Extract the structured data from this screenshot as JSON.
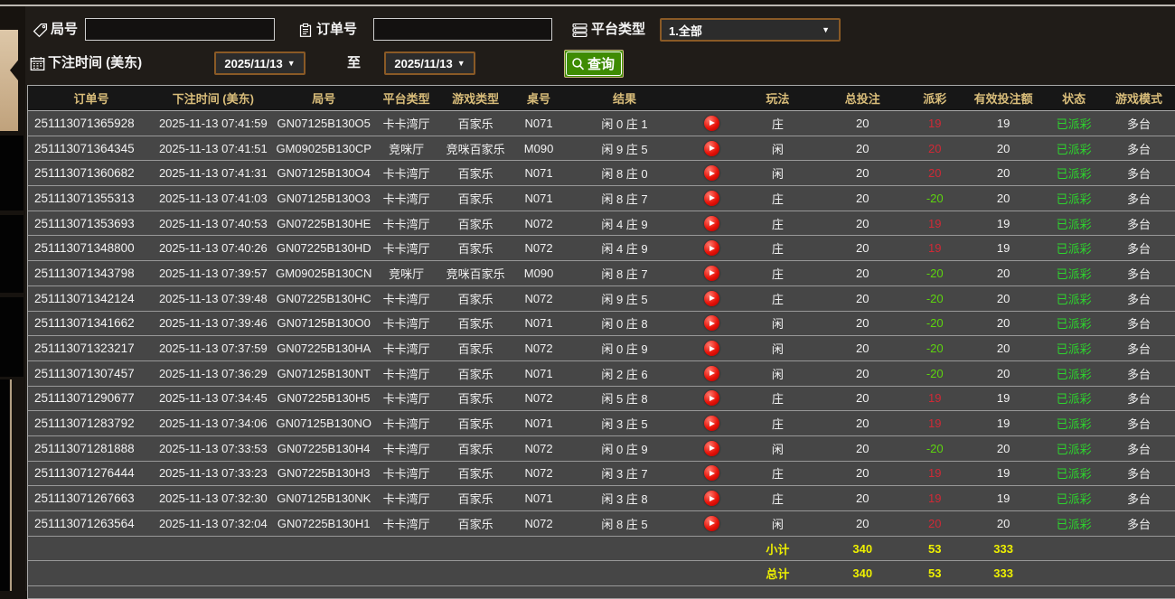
{
  "colors": {
    "payout_positive": "#d02936",
    "payout_negative": "#5dd40e",
    "status_paid_green": "#2dd42d",
    "totals_yellow": "#eef000",
    "header_gold": "#d9bd7a",
    "search_button_green": "#3e8b03",
    "dropdown_border_brown": "#8a5a26"
  },
  "filters": {
    "round": {
      "label": "局号",
      "value": ""
    },
    "order": {
      "label": "订单号",
      "value": ""
    },
    "platform": {
      "label": "平台类型",
      "value": "1.全部"
    },
    "bet_time_label": "下注时间 (美东)",
    "date_from": "2025/11/13",
    "to_label": "至",
    "date_to": "2025/11/13",
    "search_label": "查询"
  },
  "table": {
    "headers": [
      "订单号",
      "下注时间 (美东)",
      "局号",
      "平台类型",
      "游戏类型",
      "桌号",
      "结果",
      "",
      "玩法",
      "总投注",
      "派彩",
      "有效投注额",
      "状态",
      "游戏模式"
    ],
    "rows": [
      {
        "order": "251113071365928",
        "time": "2025-11-13 07:41:59",
        "round": "GN07125B130O5",
        "platform": "卡卡湾厅",
        "game": "百家乐",
        "table_no": "N071",
        "result": "闲 0 庄 1",
        "play": "庄",
        "bet": "20",
        "payout": "19",
        "valid": "19",
        "status": "已派彩",
        "mode": "多台"
      },
      {
        "order": "251113071364345",
        "time": "2025-11-13 07:41:51",
        "round": "GM09025B130CP",
        "platform": "竞咪厅",
        "game": "竞咪百家乐",
        "table_no": "M090",
        "result": "闲 9 庄 5",
        "play": "闲",
        "bet": "20",
        "payout": "20",
        "valid": "20",
        "status": "已派彩",
        "mode": "多台"
      },
      {
        "order": "251113071360682",
        "time": "2025-11-13 07:41:31",
        "round": "GN07125B130O4",
        "platform": "卡卡湾厅",
        "game": "百家乐",
        "table_no": "N071",
        "result": "闲 8 庄 0",
        "play": "闲",
        "bet": "20",
        "payout": "20",
        "valid": "20",
        "status": "已派彩",
        "mode": "多台"
      },
      {
        "order": "251113071355313",
        "time": "2025-11-13 07:41:03",
        "round": "GN07125B130O3",
        "platform": "卡卡湾厅",
        "game": "百家乐",
        "table_no": "N071",
        "result": "闲 8 庄 7",
        "play": "庄",
        "bet": "20",
        "payout": "-20",
        "valid": "20",
        "status": "已派彩",
        "mode": "多台"
      },
      {
        "order": "251113071353693",
        "time": "2025-11-13 07:40:53",
        "round": "GN07225B130HE",
        "platform": "卡卡湾厅",
        "game": "百家乐",
        "table_no": "N072",
        "result": "闲 4 庄 9",
        "play": "庄",
        "bet": "20",
        "payout": "19",
        "valid": "19",
        "status": "已派彩",
        "mode": "多台"
      },
      {
        "order": "251113071348800",
        "time": "2025-11-13 07:40:26",
        "round": "GN07225B130HD",
        "platform": "卡卡湾厅",
        "game": "百家乐",
        "table_no": "N072",
        "result": "闲 4 庄 9",
        "play": "庄",
        "bet": "20",
        "payout": "19",
        "valid": "19",
        "status": "已派彩",
        "mode": "多台"
      },
      {
        "order": "251113071343798",
        "time": "2025-11-13 07:39:57",
        "round": "GM09025B130CN",
        "platform": "竞咪厅",
        "game": "竞咪百家乐",
        "table_no": "M090",
        "result": "闲 8 庄 7",
        "play": "庄",
        "bet": "20",
        "payout": "-20",
        "valid": "20",
        "status": "已派彩",
        "mode": "多台"
      },
      {
        "order": "251113071342124",
        "time": "2025-11-13 07:39:48",
        "round": "GN07225B130HC",
        "platform": "卡卡湾厅",
        "game": "百家乐",
        "table_no": "N072",
        "result": "闲 9 庄 5",
        "play": "庄",
        "bet": "20",
        "payout": "-20",
        "valid": "20",
        "status": "已派彩",
        "mode": "多台"
      },
      {
        "order": "251113071341662",
        "time": "2025-11-13 07:39:46",
        "round": "GN07125B130O0",
        "platform": "卡卡湾厅",
        "game": "百家乐",
        "table_no": "N071",
        "result": "闲 0 庄 8",
        "play": "闲",
        "bet": "20",
        "payout": "-20",
        "valid": "20",
        "status": "已派彩",
        "mode": "多台"
      },
      {
        "order": "251113071323217",
        "time": "2025-11-13 07:37:59",
        "round": "GN07225B130HA",
        "platform": "卡卡湾厅",
        "game": "百家乐",
        "table_no": "N072",
        "result": "闲 0 庄 9",
        "play": "闲",
        "bet": "20",
        "payout": "-20",
        "valid": "20",
        "status": "已派彩",
        "mode": "多台"
      },
      {
        "order": "251113071307457",
        "time": "2025-11-13 07:36:29",
        "round": "GN07125B130NT",
        "platform": "卡卡湾厅",
        "game": "百家乐",
        "table_no": "N071",
        "result": "闲 2 庄 6",
        "play": "闲",
        "bet": "20",
        "payout": "-20",
        "valid": "20",
        "status": "已派彩",
        "mode": "多台"
      },
      {
        "order": "251113071290677",
        "time": "2025-11-13 07:34:45",
        "round": "GN07225B130H5",
        "platform": "卡卡湾厅",
        "game": "百家乐",
        "table_no": "N072",
        "result": "闲 5 庄 8",
        "play": "庄",
        "bet": "20",
        "payout": "19",
        "valid": "19",
        "status": "已派彩",
        "mode": "多台"
      },
      {
        "order": "251113071283792",
        "time": "2025-11-13 07:34:06",
        "round": "GN07125B130NO",
        "platform": "卡卡湾厅",
        "game": "百家乐",
        "table_no": "N071",
        "result": "闲 3 庄 5",
        "play": "庄",
        "bet": "20",
        "payout": "19",
        "valid": "19",
        "status": "已派彩",
        "mode": "多台"
      },
      {
        "order": "251113071281888",
        "time": "2025-11-13 07:33:53",
        "round": "GN07225B130H4",
        "platform": "卡卡湾厅",
        "game": "百家乐",
        "table_no": "N072",
        "result": "闲 0 庄 9",
        "play": "闲",
        "bet": "20",
        "payout": "-20",
        "valid": "20",
        "status": "已派彩",
        "mode": "多台"
      },
      {
        "order": "251113071276444",
        "time": "2025-11-13 07:33:23",
        "round": "GN07225B130H3",
        "platform": "卡卡湾厅",
        "game": "百家乐",
        "table_no": "N072",
        "result": "闲 3 庄 7",
        "play": "庄",
        "bet": "20",
        "payout": "19",
        "valid": "19",
        "status": "已派彩",
        "mode": "多台"
      },
      {
        "order": "251113071267663",
        "time": "2025-11-13 07:32:30",
        "round": "GN07125B130NK",
        "platform": "卡卡湾厅",
        "game": "百家乐",
        "table_no": "N071",
        "result": "闲 3 庄 8",
        "play": "庄",
        "bet": "20",
        "payout": "19",
        "valid": "19",
        "status": "已派彩",
        "mode": "多台"
      },
      {
        "order": "251113071263564",
        "time": "2025-11-13 07:32:04",
        "round": "GN07225B130H1",
        "platform": "卡卡湾厅",
        "game": "百家乐",
        "table_no": "N072",
        "result": "闲 8 庄 5",
        "play": "闲",
        "bet": "20",
        "payout": "20",
        "valid": "20",
        "status": "已派彩",
        "mode": "多台"
      }
    ],
    "subtotal": {
      "label": "小计",
      "total_bet": "340",
      "payout": "53",
      "valid_bet": "333"
    },
    "grand_total": {
      "label": "总计",
      "total_bet": "340",
      "payout": "53",
      "valid_bet": "333"
    }
  }
}
